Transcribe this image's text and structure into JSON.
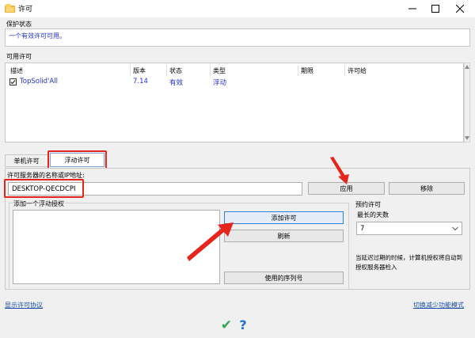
{
  "window": {
    "title": "许可",
    "minimize_label": "minimize",
    "maximize_label": "maximize",
    "close_label": "close"
  },
  "protection": {
    "label": "保护状态",
    "status": "一个有效许可可用。"
  },
  "available": {
    "label": "可用许可",
    "columns": [
      "描述",
      "版本",
      "状态",
      "类型",
      "期限",
      "许可给"
    ],
    "rows": [
      {
        "checked": true,
        "desc": "TopSolid'All",
        "version": "7.14",
        "status": "有效",
        "type": "浮动",
        "term": "",
        "licensee": ""
      }
    ]
  },
  "tabs": [
    {
      "label": "单机许可",
      "active": false
    },
    {
      "label": "浮动许可",
      "active": true
    }
  ],
  "server": {
    "label": "许可服务器的名称或IP地址:",
    "value": "DESKTOP-QECDCPI",
    "apply_label": "应用",
    "remove_label": "移除"
  },
  "floating": {
    "label": "添加一个浮动授权",
    "add_label": "添加许可",
    "refresh_label": "刷新",
    "serial_label": "使用的序列号"
  },
  "reservation": {
    "label": "预约许可",
    "max_days_label": "最长的天数",
    "max_days_value": "7",
    "note": "当延迟过期的时候，计算机授权将自动到授权服务器检入"
  },
  "footer": {
    "show_agreement": "显示许可协议",
    "switch_mode": "切换减少功能模式",
    "ok_glyph": "✔",
    "help_glyph": "?"
  },
  "colors": {
    "accent_red": "#e5261c",
    "link_blue": "#1a4ea8",
    "ok_green": "#2fa84f"
  }
}
